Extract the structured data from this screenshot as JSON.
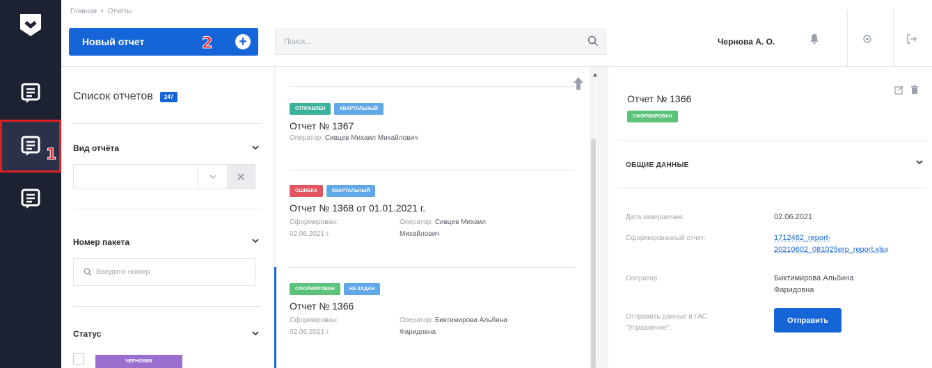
{
  "header": {
    "breadcrumb": [
      "Главная",
      "Отчёты"
    ],
    "new_report_label": "Новый отчет",
    "search_placeholder": "Поиск...",
    "user_name": "Чернова А. О."
  },
  "annotations": {
    "marker_1": "1",
    "marker_2": "2"
  },
  "filters": {
    "title": "Список отчетов",
    "count": "247",
    "report_type_label": "Вид отчёта",
    "report_type_value": "",
    "packet_number_label": "Номер пакета",
    "packet_number_placeholder": "Введите номер",
    "status_label": "Статус",
    "status_option": "ЧЕРНОВИК"
  },
  "reports": [
    {
      "tags": [
        {
          "text": "ОТПРАВЛЕН",
          "color": "#3bb39a"
        },
        {
          "text": "КВАРТАЛЬНЫЙ",
          "color": "#62a8e8"
        }
      ],
      "title": "Отчет № 1367",
      "operator_label": "Оператор:",
      "operator": "Сивцев Михаил Михайлович"
    },
    {
      "tags": [
        {
          "text": "ОШИБКА",
          "color": "#e2545f"
        },
        {
          "text": "КВАРТАЛЬНЫЙ",
          "color": "#62a8e8"
        }
      ],
      "title": "Отчет № 1368 от 01.01.2021 г.",
      "formed_label": "Сформирован:",
      "formed_date": "02.06.2021 г.",
      "operator_label": "Оператор:",
      "operator_line1": "Сивцев Михаил",
      "operator_line2": "Михайлович"
    },
    {
      "tags": [
        {
          "text": "СФОРМИРОВАН",
          "color": "#5cc27a"
        },
        {
          "text": "НЕ ЗАДАН",
          "color": "#62a8e8"
        }
      ],
      "title": "Отчет № 1366",
      "formed_label": "Сформирован:",
      "formed_date": "02.06.2021 г.",
      "operator_label": "Оператор:",
      "operator_line1": "Биктимирова Альбина",
      "operator_line2": "Фаридовна"
    }
  ],
  "detail": {
    "title": "Отчет № 1366",
    "status_tag": "СФОРМИРОВАН",
    "status_color": "#5cc27a",
    "section_title": "ОБЩИЕ ДАННЫЕ",
    "completion_label": "Дата завершения:",
    "completion_value": "02.06.2021",
    "report_label": "Сформированный отчет:",
    "report_link_line1": "1712462_report-",
    "report_link_line2": "20210602_081025erp_report.xlsx",
    "operator_label": "Оператор:",
    "operator_line1": "Биктимирова Альбина",
    "operator_line2": "Фаридовна",
    "send_label_line1": "Отправить данные в ГАС",
    "send_label_line2": "\"Управление\":",
    "send_button": "Отправить"
  },
  "colors": {
    "accent": "#1565d8",
    "rail": "#1d2233"
  }
}
